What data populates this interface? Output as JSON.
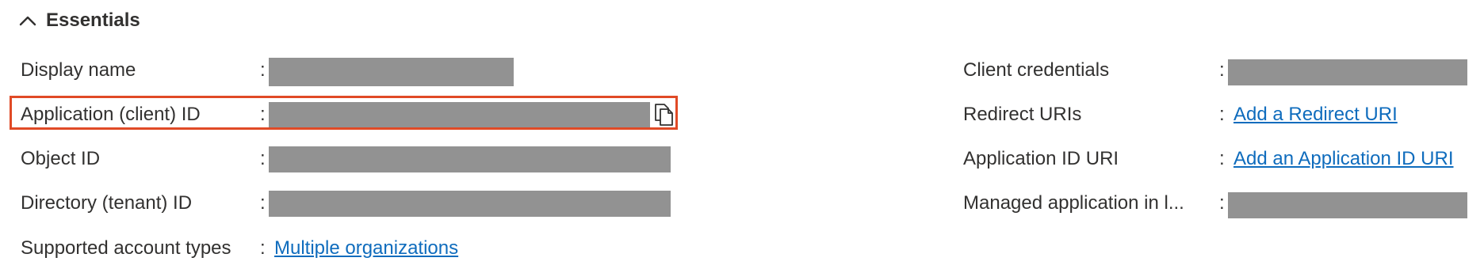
{
  "section": {
    "title": "Essentials",
    "collapse_icon": "chevron-up-icon"
  },
  "left": {
    "display_name": {
      "label": "Display name",
      "separator": ":",
      "value_redacted": true
    },
    "application_id": {
      "label": "Application (client) ID",
      "separator": ":",
      "value_redacted": true,
      "copy_icon": "copy-icon"
    },
    "object_id": {
      "label": "Object ID",
      "separator": ":",
      "value_redacted": true
    },
    "directory_id": {
      "label": "Directory (tenant) ID",
      "separator": ":",
      "value_redacted": true
    },
    "account_types": {
      "label": "Supported account types",
      "separator": ":",
      "link": "Multiple organizations"
    }
  },
  "right": {
    "client_credentials": {
      "label": "Client credentials",
      "separator": ":",
      "value_redacted": true
    },
    "redirect_uris": {
      "label": "Redirect URIs",
      "separator": ":",
      "link": "Add a Redirect URI"
    },
    "app_id_uri": {
      "label": "Application ID URI",
      "separator": ":",
      "link": "Add an Application ID URI"
    },
    "managed_app": {
      "label": "Managed application in l...",
      "separator": ":",
      "value_redacted": true
    }
  },
  "colors": {
    "link": "#0f6cbd",
    "highlight_border": "#e04a26",
    "redaction": "#929292",
    "text": "#323130"
  }
}
